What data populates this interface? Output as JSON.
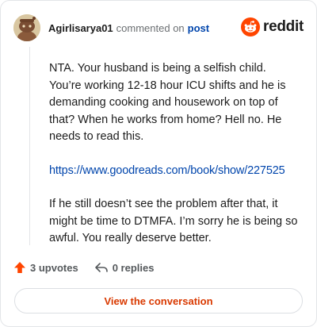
{
  "header": {
    "username": "Agirlisarya01",
    "action_text": "commented on",
    "post_link_label": "post",
    "brand_name": "reddit"
  },
  "comment": {
    "paragraphs": [
      "NTA. Your husband is being a selfish child. You’re working 12-18 hour ICU shifts and he is demanding cooking and housework on top of that? When he works from home? Hell no. He needs to read this.",
      "If he still doesn’t see the problem after that, it might be time to DTMFA. I’m sorry he is being so awful. You really deserve better."
    ],
    "link_text": "https://www.goodreads.com/book/show/227525"
  },
  "actions": {
    "upvotes_label": "3 upvotes",
    "replies_label": "0 replies"
  },
  "cta": {
    "label": "View the conversation"
  },
  "colors": {
    "accent": "#d93900",
    "link": "#0045ac",
    "upvote": "#ff4500",
    "text": "#1c1c1c",
    "muted": "#6b6f72",
    "border": "#e3e5e8"
  },
  "icons": {
    "avatar": "snoo-avatar",
    "brand": "reddit-logo-icon",
    "upvote": "upvote-arrow-icon",
    "reply": "reply-arrow-icon"
  }
}
